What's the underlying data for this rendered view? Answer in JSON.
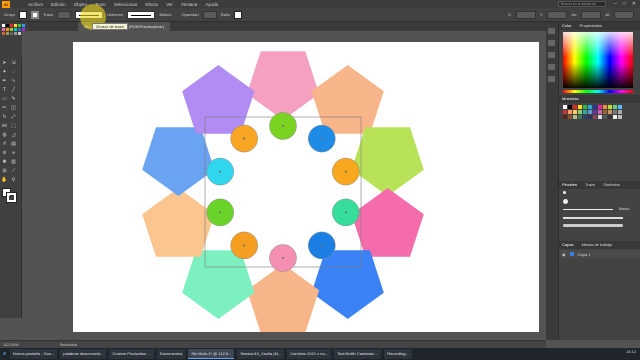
{
  "menubar": {
    "logo": "Ai",
    "items": [
      "Archivo",
      "Edición",
      "Objeto",
      "Texto",
      "Seleccionar",
      "Efecto",
      "Ver",
      "Ventana",
      "Ayuda"
    ],
    "search_placeholder": "Buscar en la ayuda de Adobe"
  },
  "controlbar": {
    "group_label": "Grupo",
    "stroke_label": "Trazo",
    "brush_label": "Uniforme",
    "style_label": "Básico",
    "opacity_label": "Opacidad",
    "style2_label": "Estilo",
    "coords": [
      "X:",
      "Y:",
      "An:",
      "Al:"
    ]
  },
  "document_tab": {
    "title": "Sin título-1* @ 112,93 % (RGB/Previsualizar)"
  },
  "tooltip": {
    "text": "Grosor de trazo"
  },
  "statusbar": {
    "zoom": "112,93%",
    "tool": "Selección"
  },
  "panels": {
    "color_tabs": [
      "Color",
      "Propiedades"
    ],
    "swatches_title": "Muestras",
    "brush_tabs": [
      "Pinceles",
      "Trazo",
      "Símbolos"
    ],
    "brush_basic": "Básico",
    "layers_tabs": [
      "Capas",
      "Mesas de trabajo"
    ],
    "layer_name": "Capa 1"
  },
  "taskbar": {
    "tasks": [
      "Nueva pestaña - Goo...",
      "palabras desconocid...",
      "Custom Production ...",
      "Documentos",
      "Sin título-1* @ 112,9...",
      "Session10_Xsolla (M...",
      "Cambios 2021 x no...",
      "TechSmith Camtasia ...",
      "Recording..."
    ],
    "time": "14:12"
  },
  "colors": {
    "pentagons": [
      "#f5a0c0",
      "#f9b58a",
      "#b8e358",
      "#f56caa",
      "#3b82f6",
      "#f9b58a",
      "#7df0bf",
      "#fbc590",
      "#6aa3f2",
      "#b18cf2"
    ],
    "circles": [
      "#7ad321",
      "#1e8ce6",
      "#f8a81e",
      "#37dd9a",
      "#1b7fe4",
      "#f48fb1",
      "#f59e21",
      "#6ad32a",
      "#2fd6ee",
      "#f8a623"
    ]
  }
}
